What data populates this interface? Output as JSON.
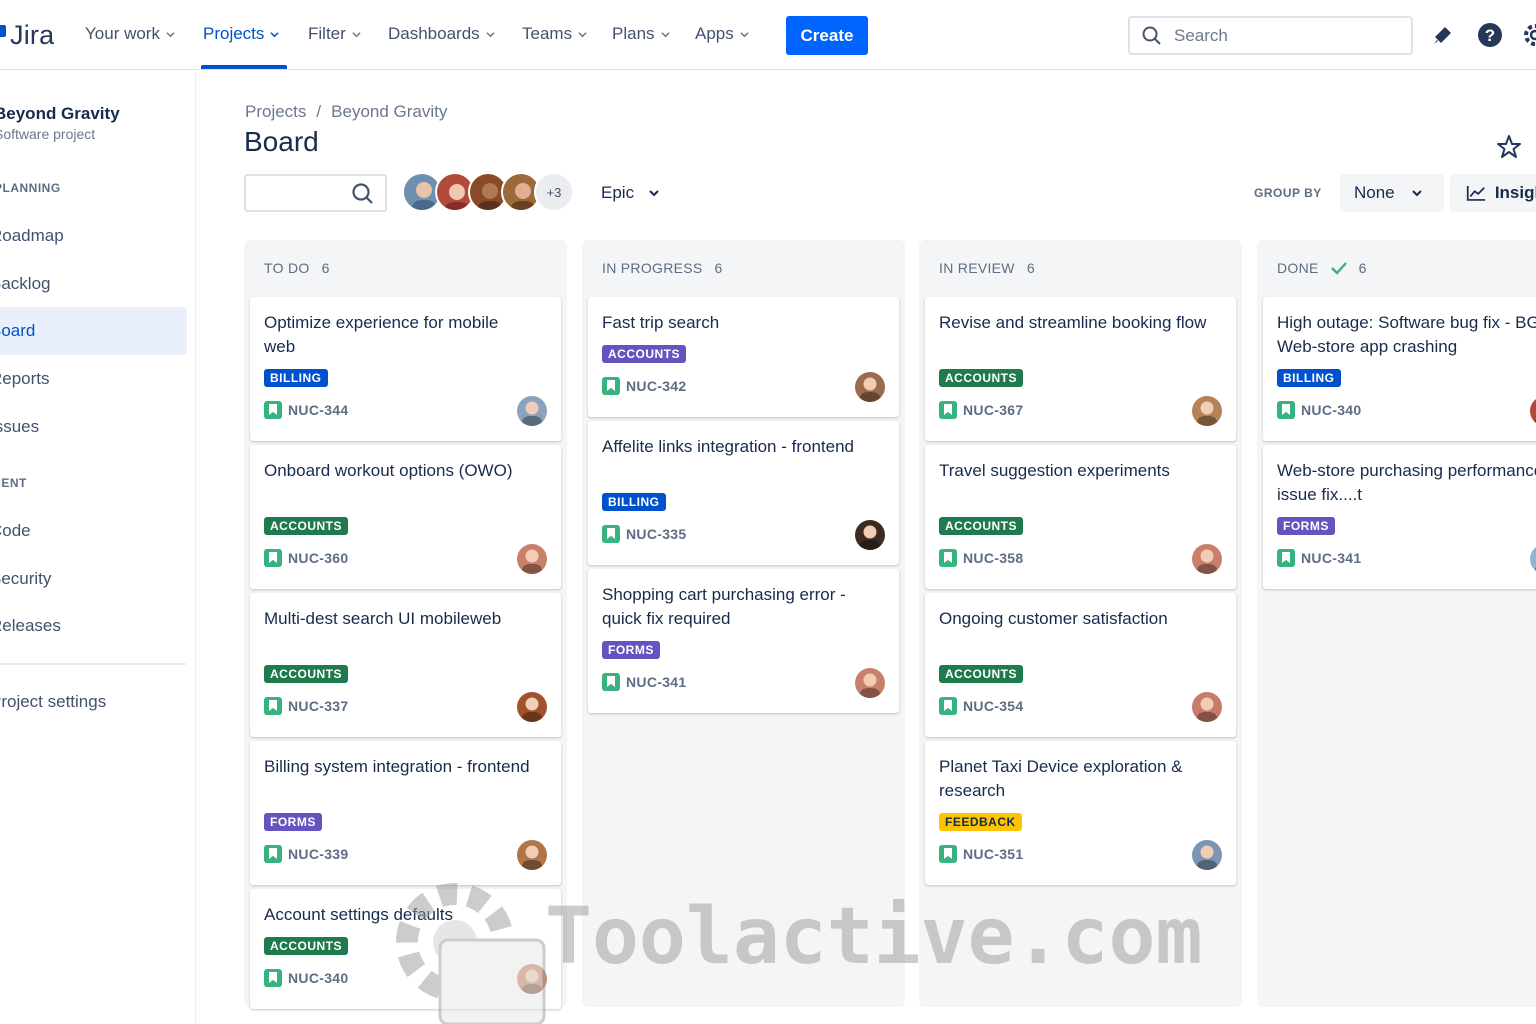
{
  "topnav": {
    "logo_text": "Jira",
    "items": [
      {
        "label": "Your work",
        "active": false
      },
      {
        "label": "Projects",
        "active": true
      },
      {
        "label": "Filter",
        "active": false
      },
      {
        "label": "Dashboards",
        "active": false
      },
      {
        "label": "Teams",
        "active": false
      },
      {
        "label": "Plans",
        "active": false
      },
      {
        "label": "Apps",
        "active": false
      }
    ],
    "create_label": "Create",
    "search_placeholder": "Search",
    "accent": "#0052cc"
  },
  "sidebar": {
    "project_name": "Beyond Gravity",
    "project_type": "Software project",
    "section_planning": "PLANNING",
    "items_planning": [
      {
        "label": "Roadmap",
        "active": false
      },
      {
        "label": "Backlog",
        "active": false
      },
      {
        "label": "Board",
        "active": true
      },
      {
        "label": "Reports",
        "active": false
      },
      {
        "label": "Issues",
        "active": false
      }
    ],
    "section_dev": "DEVELOPMENT",
    "items_dev": [
      {
        "label": "Code"
      },
      {
        "label": "Security"
      },
      {
        "label": "Releases"
      }
    ],
    "project_settings": "Project settings"
  },
  "header": {
    "breadcrumb": [
      "Projects",
      "/",
      "Beyond Gravity"
    ],
    "title": "Board",
    "avatars_more": "+3",
    "epic_label": "Epic",
    "group_by_label": "GROUP BY",
    "group_by_value": "None",
    "insights_label": "Insights"
  },
  "columns": [
    {
      "name": "TO DO",
      "count": "6",
      "done": false,
      "cards": [
        {
          "title": "Optimize experience for mobile web",
          "label": "BILLING",
          "label_type": "billing",
          "key": "NUC-344",
          "avatar_color": "#8aa4c0"
        },
        {
          "title": "Onboard workout options (OWO)",
          "label": "ACCOUNTS",
          "label_type": "accounts",
          "key": "NUC-360",
          "avatar_color": "#c9806b"
        },
        {
          "title": "Multi-dest search UI mobileweb",
          "label": "ACCOUNTS",
          "label_type": "accounts",
          "key": "NUC-337",
          "avatar_color": "#a0522d"
        },
        {
          "title": "Billing system integration - frontend",
          "label": "FORMS",
          "label_type": "forms",
          "key": "NUC-339",
          "avatar_color": "#b0764a"
        },
        {
          "title": "Account settings defaults",
          "label": "ACCOUNTS",
          "label_type": "accounts",
          "key": "NUC-340",
          "avatar_color": "#c98a6b"
        }
      ]
    },
    {
      "name": "IN PROGRESS",
      "count": "6",
      "done": false,
      "cards": [
        {
          "title": "Fast trip search",
          "label": "ACCOUNTS",
          "label_type": "forms",
          "key": "NUC-342",
          "avatar_color": "#9c6b4e"
        },
        {
          "title": "Affelite links integration - frontend",
          "label": "BILLING",
          "label_type": "billing",
          "key": "NUC-335",
          "avatar_color": "#3d2b22"
        },
        {
          "title": "Shopping cart purchasing error - quick fix required",
          "label": "FORMS",
          "label_type": "forms",
          "key": "NUC-341",
          "avatar_color": "#c9806b"
        }
      ]
    },
    {
      "name": "IN REVIEW",
      "count": "6",
      "done": false,
      "cards": [
        {
          "title": "Revise and streamline booking flow",
          "label": "ACCOUNTS",
          "label_type": "accounts",
          "key": "NUC-367",
          "avatar_color": "#b5835a"
        },
        {
          "title": "Travel suggestion experiments",
          "label": "ACCOUNTS",
          "label_type": "accounts",
          "key": "NUC-358",
          "avatar_color": "#c9806b"
        },
        {
          "title": "Ongoing customer satisfaction",
          "label": "ACCOUNTS",
          "label_type": "accounts",
          "key": "NUC-354",
          "avatar_color": "#c97b6b"
        },
        {
          "title": "Planet Taxi Device exploration & research",
          "label": "FEEDBACK",
          "label_type": "feedback",
          "key": "NUC-351",
          "avatar_color": "#7d95b5"
        }
      ]
    },
    {
      "name": "DONE",
      "count": "6",
      "done": true,
      "cards": [
        {
          "title": "High outage: Software bug fix - BG Web-store app crashing",
          "label": "BILLING",
          "label_type": "billing",
          "key": "NUC-340",
          "avatar_color": "#b24a3a"
        },
        {
          "title": "Web-store purchasing performance issue fix....t",
          "label": "FORMS",
          "label_type": "forms",
          "key": "NUC-341",
          "avatar_color": "#8fb5d0"
        }
      ]
    }
  ],
  "watermark": "Toolactive.com"
}
